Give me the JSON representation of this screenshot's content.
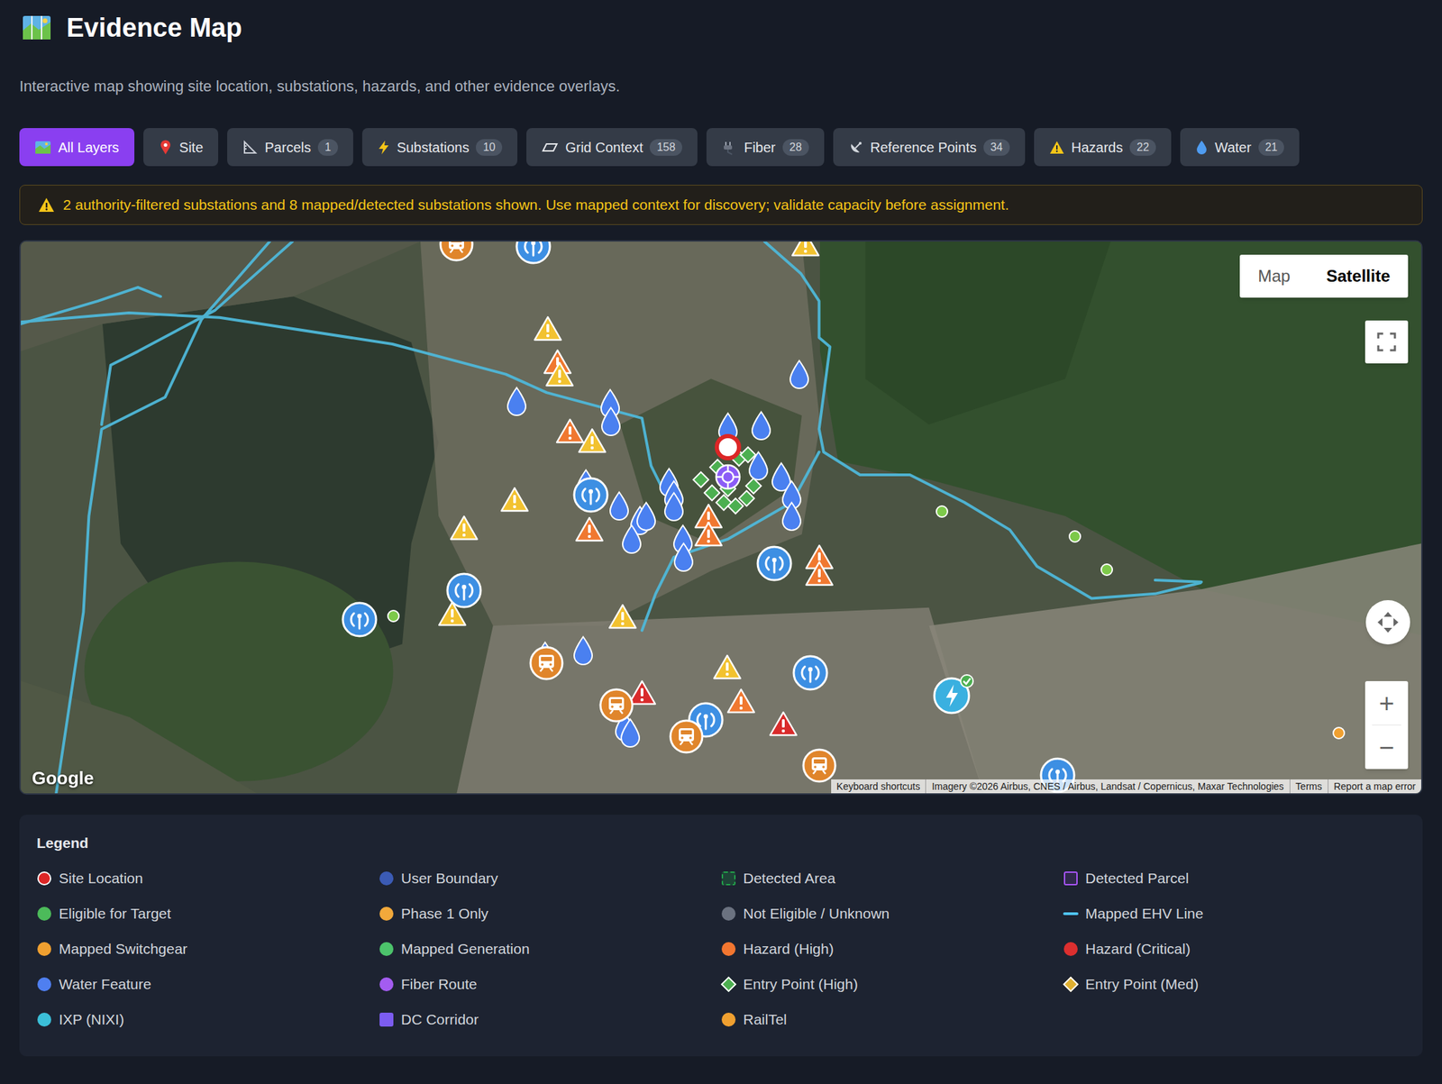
{
  "page": {
    "title": "Evidence Map",
    "subtitle": "Interactive map showing site location, substations, hazards, and other evidence overlays."
  },
  "filters": [
    {
      "label": "All Layers",
      "selected": true
    },
    {
      "label": "Site",
      "selected": false
    },
    {
      "label": "Parcels",
      "count": "1",
      "selected": false
    },
    {
      "label": "Substations",
      "count": "10",
      "selected": false
    },
    {
      "label": "Grid Context",
      "count": "158",
      "selected": false
    },
    {
      "label": "Fiber",
      "count": "28",
      "selected": false
    },
    {
      "label": "Reference Points",
      "count": "34",
      "selected": false
    },
    {
      "label": "Hazards",
      "count": "22",
      "selected": false
    },
    {
      "label": "Water",
      "count": "21",
      "selected": false
    }
  ],
  "banner": {
    "text": "2 authority-filtered substations and 8 mapped/detected substations shown. Use mapped context for discovery; validate capacity before assignment."
  },
  "map": {
    "types": [
      {
        "label": "Map",
        "selected": false
      },
      {
        "label": "Satellite",
        "selected": true
      }
    ],
    "logo": "Google",
    "zoom_in": "+",
    "zoom_out": "−",
    "attribution": [
      "Keyboard shortcuts",
      "Imagery ©2026 Airbus, CNES / Airbus, Landsat / Copernicus, Maxar Technologies",
      "Terms",
      "Report a map error"
    ]
  },
  "markers": [
    {
      "kind": "hazard",
      "color": "#f2c230"
    },
    {
      "kind": "hazard",
      "color": "#f2c230"
    },
    {
      "kind": "hazard",
      "color": "#f07830"
    },
    {
      "kind": "hazard",
      "color": "#f2c230"
    },
    {
      "kind": "hazard",
      "color": "#f07830"
    },
    {
      "kind": "hazard",
      "color": "#f2c230"
    },
    {
      "kind": "hazard",
      "color": "#f2c230"
    },
    {
      "kind": "hazard",
      "color": "#f2c230"
    },
    {
      "kind": "hazard",
      "color": "#f07830"
    },
    {
      "kind": "hazard",
      "color": "#f07830"
    },
    {
      "kind": "hazard",
      "color": "#f07830"
    },
    {
      "kind": "hazard",
      "color": "#f07830"
    },
    {
      "kind": "hazard",
      "color": "#f07830"
    },
    {
      "kind": "hazard",
      "color": "#f2c230"
    },
    {
      "kind": "hazard",
      "color": "#f2c230"
    },
    {
      "kind": "hazard",
      "color": "#f2c230"
    },
    {
      "kind": "hazard",
      "color": "#f07830"
    },
    {
      "kind": "hazard",
      "color": "#d92b2b"
    },
    {
      "kind": "hazard",
      "color": "#d92b2b"
    },
    {
      "kind": "water",
      "color": "#4a80f0"
    },
    {
      "kind": "water",
      "color": "#4a80f0"
    },
    {
      "kind": "water",
      "color": "#4a80f0"
    },
    {
      "kind": "water",
      "color": "#4a80f0"
    },
    {
      "kind": "water",
      "color": "#4a80f0"
    },
    {
      "kind": "water",
      "color": "#4a80f0"
    },
    {
      "kind": "water",
      "color": "#4a80f0"
    },
    {
      "kind": "water",
      "color": "#4a80f0"
    },
    {
      "kind": "water",
      "color": "#4a80f0"
    },
    {
      "kind": "water",
      "color": "#4a80f0"
    },
    {
      "kind": "water",
      "color": "#4a80f0"
    },
    {
      "kind": "water",
      "color": "#4a80f0"
    },
    {
      "kind": "water",
      "color": "#4a80f0"
    },
    {
      "kind": "water",
      "color": "#4a80f0"
    },
    {
      "kind": "water",
      "color": "#4a80f0"
    },
    {
      "kind": "water",
      "color": "#4a80f0"
    },
    {
      "kind": "water",
      "color": "#4a80f0"
    },
    {
      "kind": "water",
      "color": "#4a80f0"
    },
    {
      "kind": "water",
      "color": "#4a80f0"
    },
    {
      "kind": "water",
      "color": "#4a80f0"
    },
    {
      "kind": "water",
      "color": "#4a80f0"
    },
    {
      "kind": "water",
      "color": "#4a80f0"
    },
    {
      "kind": "water",
      "color": "#4a80f0"
    },
    {
      "kind": "water",
      "color": "#4a80f0"
    },
    {
      "kind": "reference",
      "color": "#3d8fe3"
    },
    {
      "kind": "reference",
      "color": "#3d8fe3"
    },
    {
      "kind": "reference",
      "color": "#3d8fe3"
    },
    {
      "kind": "reference",
      "color": "#3d8fe3"
    },
    {
      "kind": "reference",
      "color": "#3d8fe3"
    },
    {
      "kind": "reference",
      "color": "#3d8fe3"
    },
    {
      "kind": "reference",
      "color": "#3d8fe3"
    },
    {
      "kind": "reference",
      "color": "#3d8fe3"
    },
    {
      "kind": "railtel",
      "color": "#e0852b"
    },
    {
      "kind": "railtel",
      "color": "#e0852b"
    },
    {
      "kind": "railtel",
      "color": "#e0852b"
    },
    {
      "kind": "railtel",
      "color": "#e0852b"
    },
    {
      "kind": "railtel",
      "color": "#e0852b"
    },
    {
      "kind": "dot",
      "color": "#7dc94a"
    },
    {
      "kind": "dot",
      "color": "#7dc94a"
    },
    {
      "kind": "dot",
      "color": "#7dc94a"
    },
    {
      "kind": "dot",
      "color": "#7dc94a"
    },
    {
      "kind": "dot",
      "color": "#f0a030"
    },
    {
      "kind": "substation",
      "color": "#3ab0e0"
    },
    {
      "kind": "entry",
      "color": "#4caf50"
    },
    {
      "kind": "entry",
      "color": "#4caf50"
    },
    {
      "kind": "entry",
      "color": "#4caf50"
    },
    {
      "kind": "entry",
      "color": "#4caf50"
    },
    {
      "kind": "entry",
      "color": "#4caf50"
    },
    {
      "kind": "entry",
      "color": "#4caf50"
    },
    {
      "kind": "entry",
      "color": "#4caf50"
    },
    {
      "kind": "entry",
      "color": "#4caf50"
    },
    {
      "kind": "entry",
      "color": "#4caf50"
    },
    {
      "kind": "entry",
      "color": "#4caf50"
    },
    {
      "kind": "site",
      "color": "#dc2626"
    },
    {
      "kind": "parcel",
      "color": "#8b5cf6"
    }
  ],
  "legend": {
    "title": "Legend",
    "items": [
      {
        "label": "Site Location",
        "kind": "ring",
        "color": "#dc2626"
      },
      {
        "label": "User Boundary",
        "kind": "dot",
        "color": "#3b5bb5"
      },
      {
        "label": "Detected Area",
        "kind": "dashed-square",
        "color": "#22a34a"
      },
      {
        "label": "Detected Parcel",
        "kind": "outline-square",
        "color": "#a855f7"
      },
      {
        "label": "Eligible for Target",
        "kind": "dot",
        "color": "#4cbb5a"
      },
      {
        "label": "Phase 1 Only",
        "kind": "dot",
        "color": "#f2a93b"
      },
      {
        "label": "Not Eligible / Unknown",
        "kind": "dot",
        "color": "#6b7280"
      },
      {
        "label": "Mapped EHV Line",
        "kind": "line",
        "color": "#4fc3f7"
      },
      {
        "label": "Mapped Switchgear",
        "kind": "dot",
        "color": "#f0a030"
      },
      {
        "label": "Mapped Generation",
        "kind": "dot",
        "color": "#4cc36b"
      },
      {
        "label": "Hazard (High)",
        "kind": "dot",
        "color": "#f27630"
      },
      {
        "label": "Hazard (Critical)",
        "kind": "dot",
        "color": "#dc2f2f"
      },
      {
        "label": "Water Feature",
        "kind": "dot",
        "color": "#4f7ff0"
      },
      {
        "label": "Fiber Route",
        "kind": "dot",
        "color": "#a35cf0"
      },
      {
        "label": "Entry Point (High)",
        "kind": "diamond",
        "color": "#4caf50"
      },
      {
        "label": "Entry Point (Med)",
        "kind": "diamond",
        "color": "#e0b030"
      },
      {
        "label": "IXP (NIXI)",
        "kind": "dot",
        "color": "#3bbfd8"
      },
      {
        "label": "DC Corridor",
        "kind": "square",
        "color": "#7c5cf0"
      },
      {
        "label": "RailTel",
        "kind": "dot",
        "color": "#f0a030"
      }
    ]
  }
}
